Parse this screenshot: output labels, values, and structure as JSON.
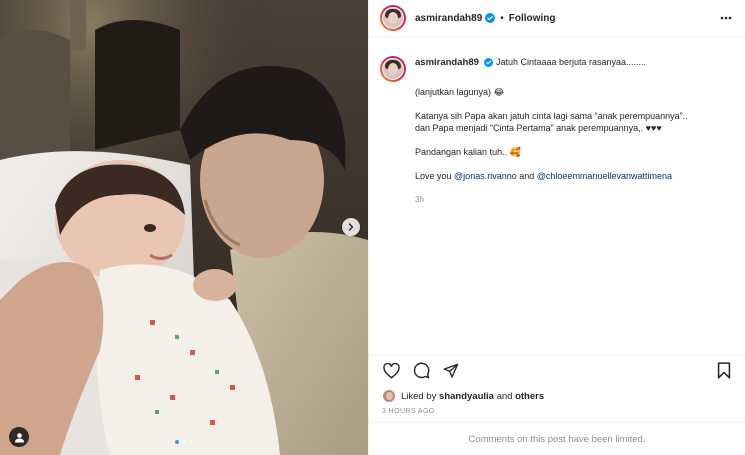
{
  "post": {
    "username": "asmirandah89",
    "follow_status": "Following",
    "separator": "•",
    "caption": {
      "username": "asmirandah89",
      "line1": "Jatuh Cintaaaa berjuta rasanyaa........",
      "line2_text": "(lanjutkan lagunya)",
      "line2_emoji": "😂",
      "line3a": "Katanya sih Papa akan jatuh cinta lagi sama “anak perempuannya”..",
      "line3b": "dan Papa menjadi “Cinta Pertama” anak perempuannya,. ♥♥♥",
      "line4_text": "Pandangan kalian tuh..",
      "line4_emoji": "🥰",
      "love_prefix": "Love you",
      "mention1": "@jonas.rivanno",
      "and_word": "and",
      "mention2": "@chloeemmanuellevanwattimena",
      "time": "3h"
    },
    "likes": {
      "prefix": "Liked by",
      "user": "shandyaulia",
      "middle": "and",
      "others": "others"
    },
    "timestamp": "3 HOURS AGO",
    "comments_notice": "Comments on this post have been limited.",
    "carousel": {
      "count": 3,
      "active_index": 0
    }
  },
  "icons": {
    "verified": "verified-badge-icon",
    "more": "more-options-icon",
    "like": "heart-icon",
    "comment": "comment-icon",
    "share": "share-icon",
    "save": "bookmark-icon",
    "next": "chevron-right-icon",
    "tag": "tagged-user-icon"
  },
  "colors": {
    "accent": "#0095f6",
    "text": "#262626",
    "muted": "#8e8e8e",
    "mention": "#00376b",
    "border": "#efefef"
  }
}
